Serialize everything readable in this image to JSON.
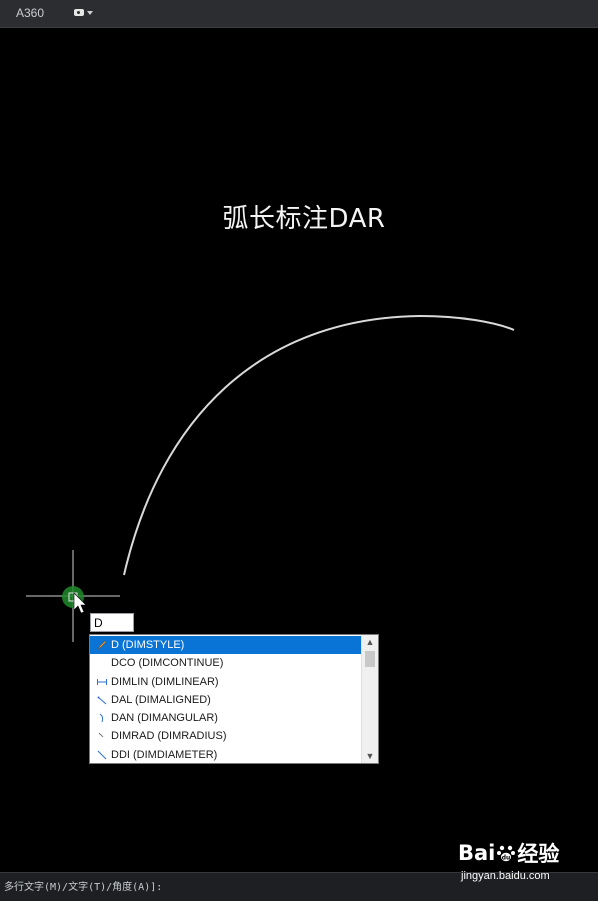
{
  "app": {
    "title": "A360"
  },
  "overlay": {
    "title": "弧长标注DAR"
  },
  "command": {
    "input_value": "D"
  },
  "autocomplete": {
    "items": [
      {
        "label": "D (DIMSTYLE)",
        "icon": "dimstyle-icon",
        "selected": true
      },
      {
        "label": "DCO (DIMCONTINUE)",
        "icon": "none",
        "selected": false
      },
      {
        "label": "DIMLIN (DIMLINEAR)",
        "icon": "dimlinear-icon",
        "selected": false
      },
      {
        "label": "DAL (DIMALIGNED)",
        "icon": "dimaligned-icon",
        "selected": false
      },
      {
        "label": "DAN (DIMANGULAR)",
        "icon": "dimangular-icon",
        "selected": false
      },
      {
        "label": "DIMRAD (DIMRADIUS)",
        "icon": "dimradius-icon",
        "selected": false
      },
      {
        "label": "DDI (DIMDIAMETER)",
        "icon": "dimdiameter-icon",
        "selected": false
      }
    ]
  },
  "cmdline": {
    "prompt": "多行文字(M)/文字(T)/角度(A)]:"
  },
  "watermark": {
    "logo_text_left": "Bai",
    "logo_text_right": "经验",
    "url": "jingyan.baidu.com"
  },
  "colors": {
    "selected_row": "#0a74d6",
    "cursor_glow": "#1f8a2a",
    "arc": "#d9d9d9"
  }
}
